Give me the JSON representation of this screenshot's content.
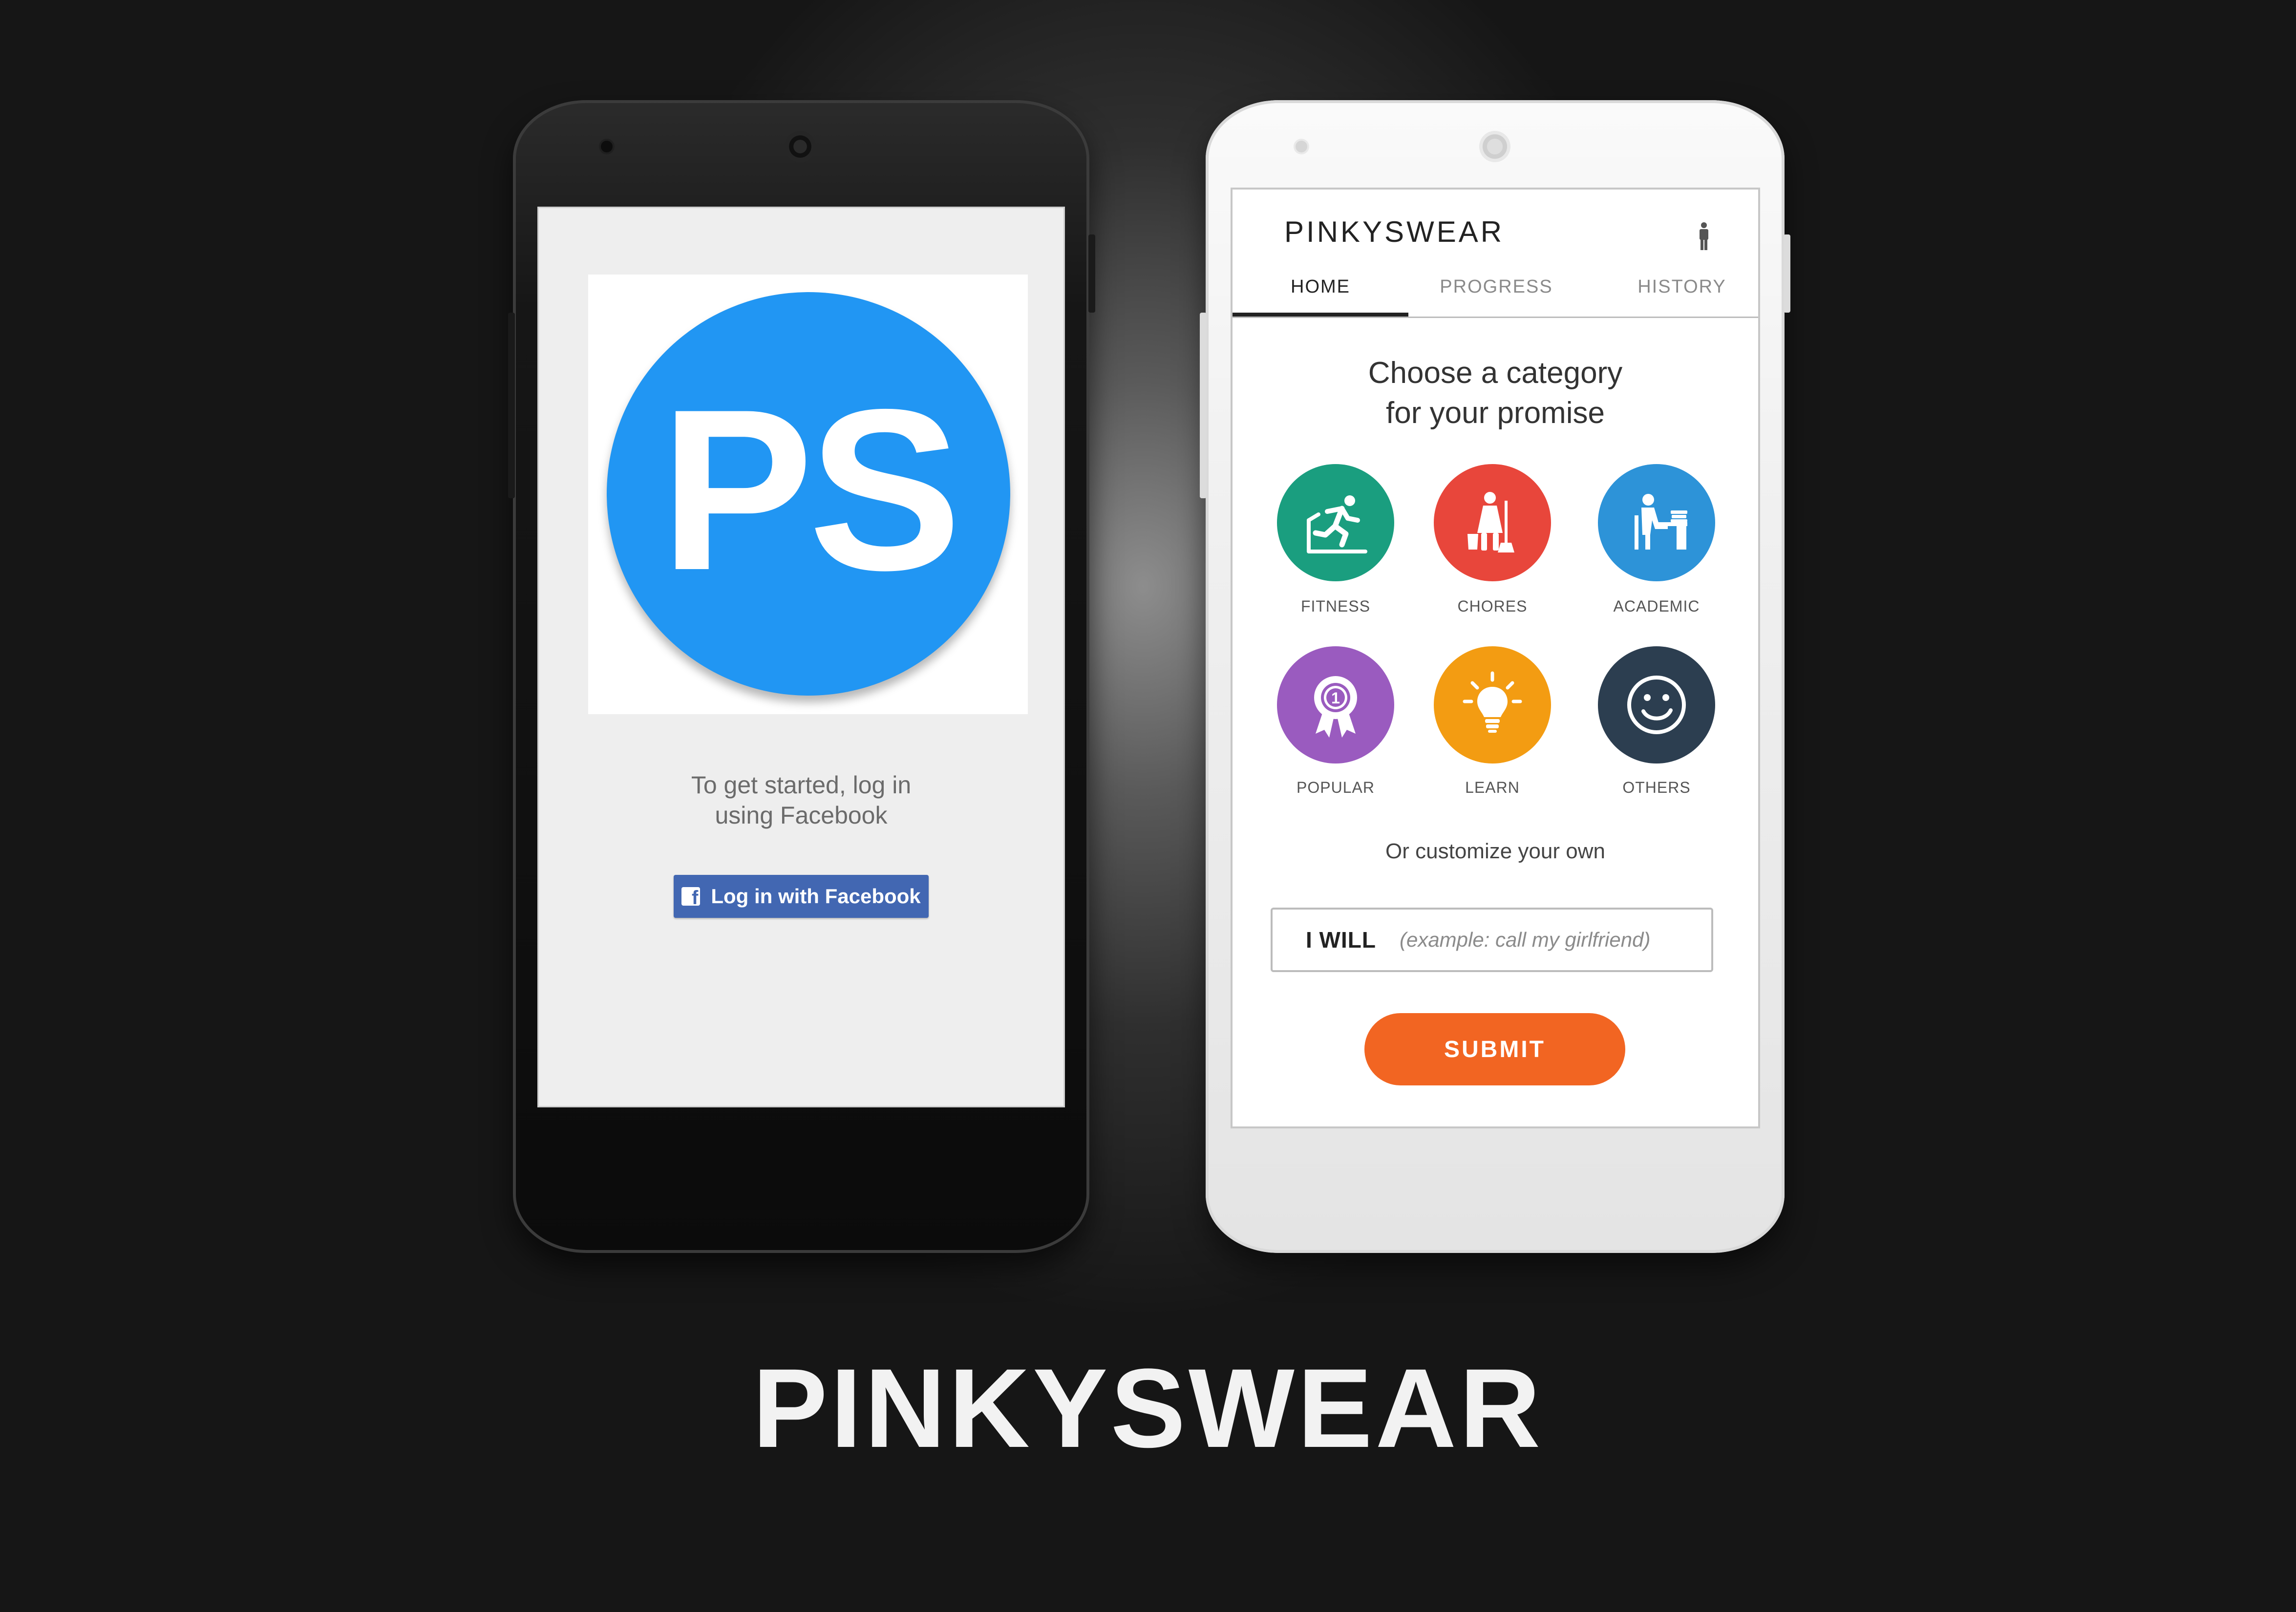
{
  "left_phone": {
    "logo_text": "PS",
    "intro_text": "To get started, log in\nusing Facebook",
    "facebook_button_label": "Log in with Facebook"
  },
  "right_phone": {
    "app_title": "PINKYSWEAR",
    "tabs": [
      {
        "label": "HOME",
        "active": true
      },
      {
        "label": "PROGRESS",
        "active": false
      },
      {
        "label": "HISTORY",
        "active": false
      }
    ],
    "heading": "Choose a category\nfor your promise",
    "categories": [
      {
        "label": "FITNESS",
        "icon": "running-person-icon",
        "color": "#1a9e7f"
      },
      {
        "label": "CHORES",
        "icon": "cleaning-person-icon",
        "color": "#e8463b"
      },
      {
        "label": "ACADEMIC",
        "icon": "studying-person-icon",
        "color": "#2d93d8"
      },
      {
        "label": "POPULAR",
        "icon": "award-ribbon-icon",
        "color": "#9a5bbf"
      },
      {
        "label": "LEARN",
        "icon": "lightbulb-icon",
        "color": "#f39c12"
      },
      {
        "label": "OTHERS",
        "icon": "smiley-face-icon",
        "color": "#2c3e50"
      }
    ],
    "customize_text": "Or customize your own",
    "will_label": "I WILL",
    "will_placeholder": "(example: call my girlfriend)",
    "submit_label": "SUBMIT",
    "accent_color": "#f26522"
  },
  "brand_title": "PINKYSWEAR"
}
